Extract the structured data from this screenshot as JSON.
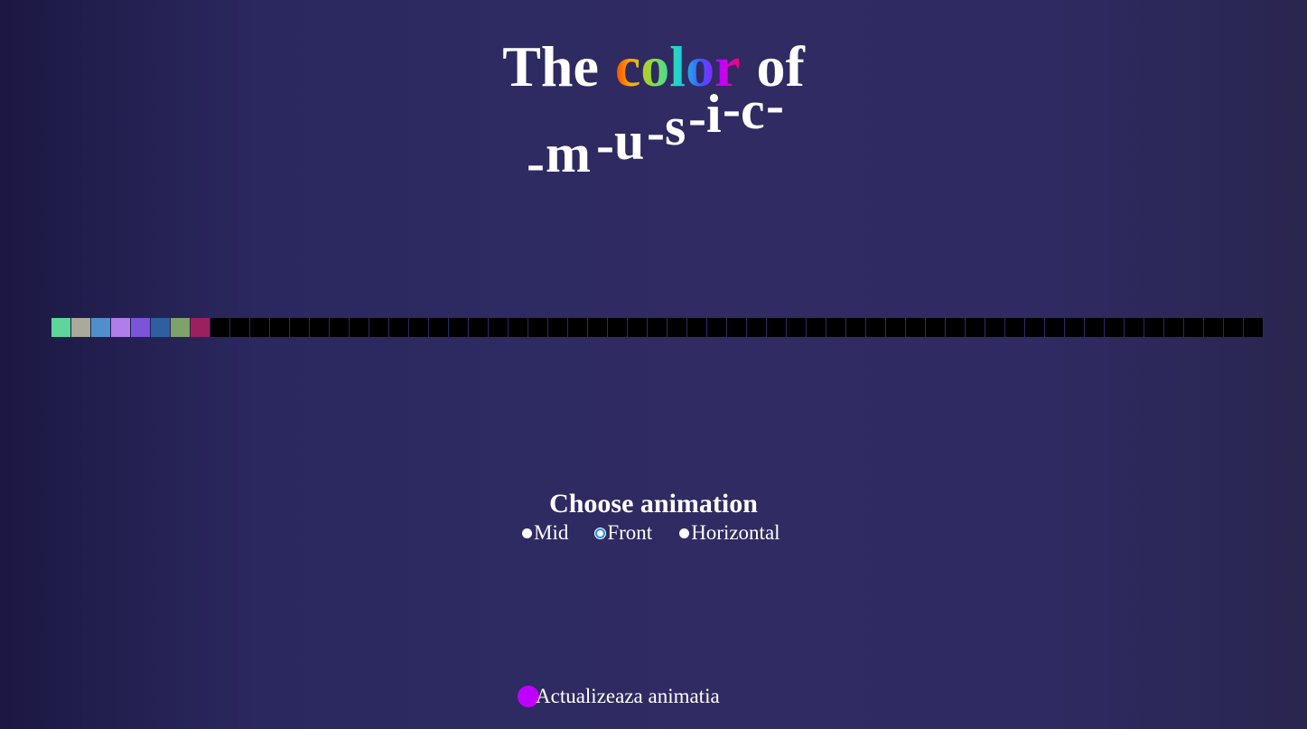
{
  "title": {
    "word1": "The",
    "word2": "color",
    "word3": "of",
    "music_parts": [
      "-",
      "m",
      "-",
      "u",
      "-",
      "s",
      "-",
      "i",
      "-",
      "c",
      "-"
    ]
  },
  "visualizer": {
    "active_colors": [
      "#5cd69a",
      "#a9a99c",
      "#4f8fcc",
      "#b07ee8",
      "#7a55d8",
      "#2f5f9e",
      "#7ea36a",
      "#9b2060"
    ],
    "inactive_color": "#000000",
    "total_squares": 61
  },
  "animation": {
    "heading": "Choose animation",
    "options": [
      {
        "label": "Mid",
        "checked": false
      },
      {
        "label": "Front",
        "checked": true
      },
      {
        "label": "Horizontal",
        "checked": false
      }
    ]
  },
  "refresh": {
    "label": "Actualizeaza animatia",
    "color": "#c000ff"
  }
}
